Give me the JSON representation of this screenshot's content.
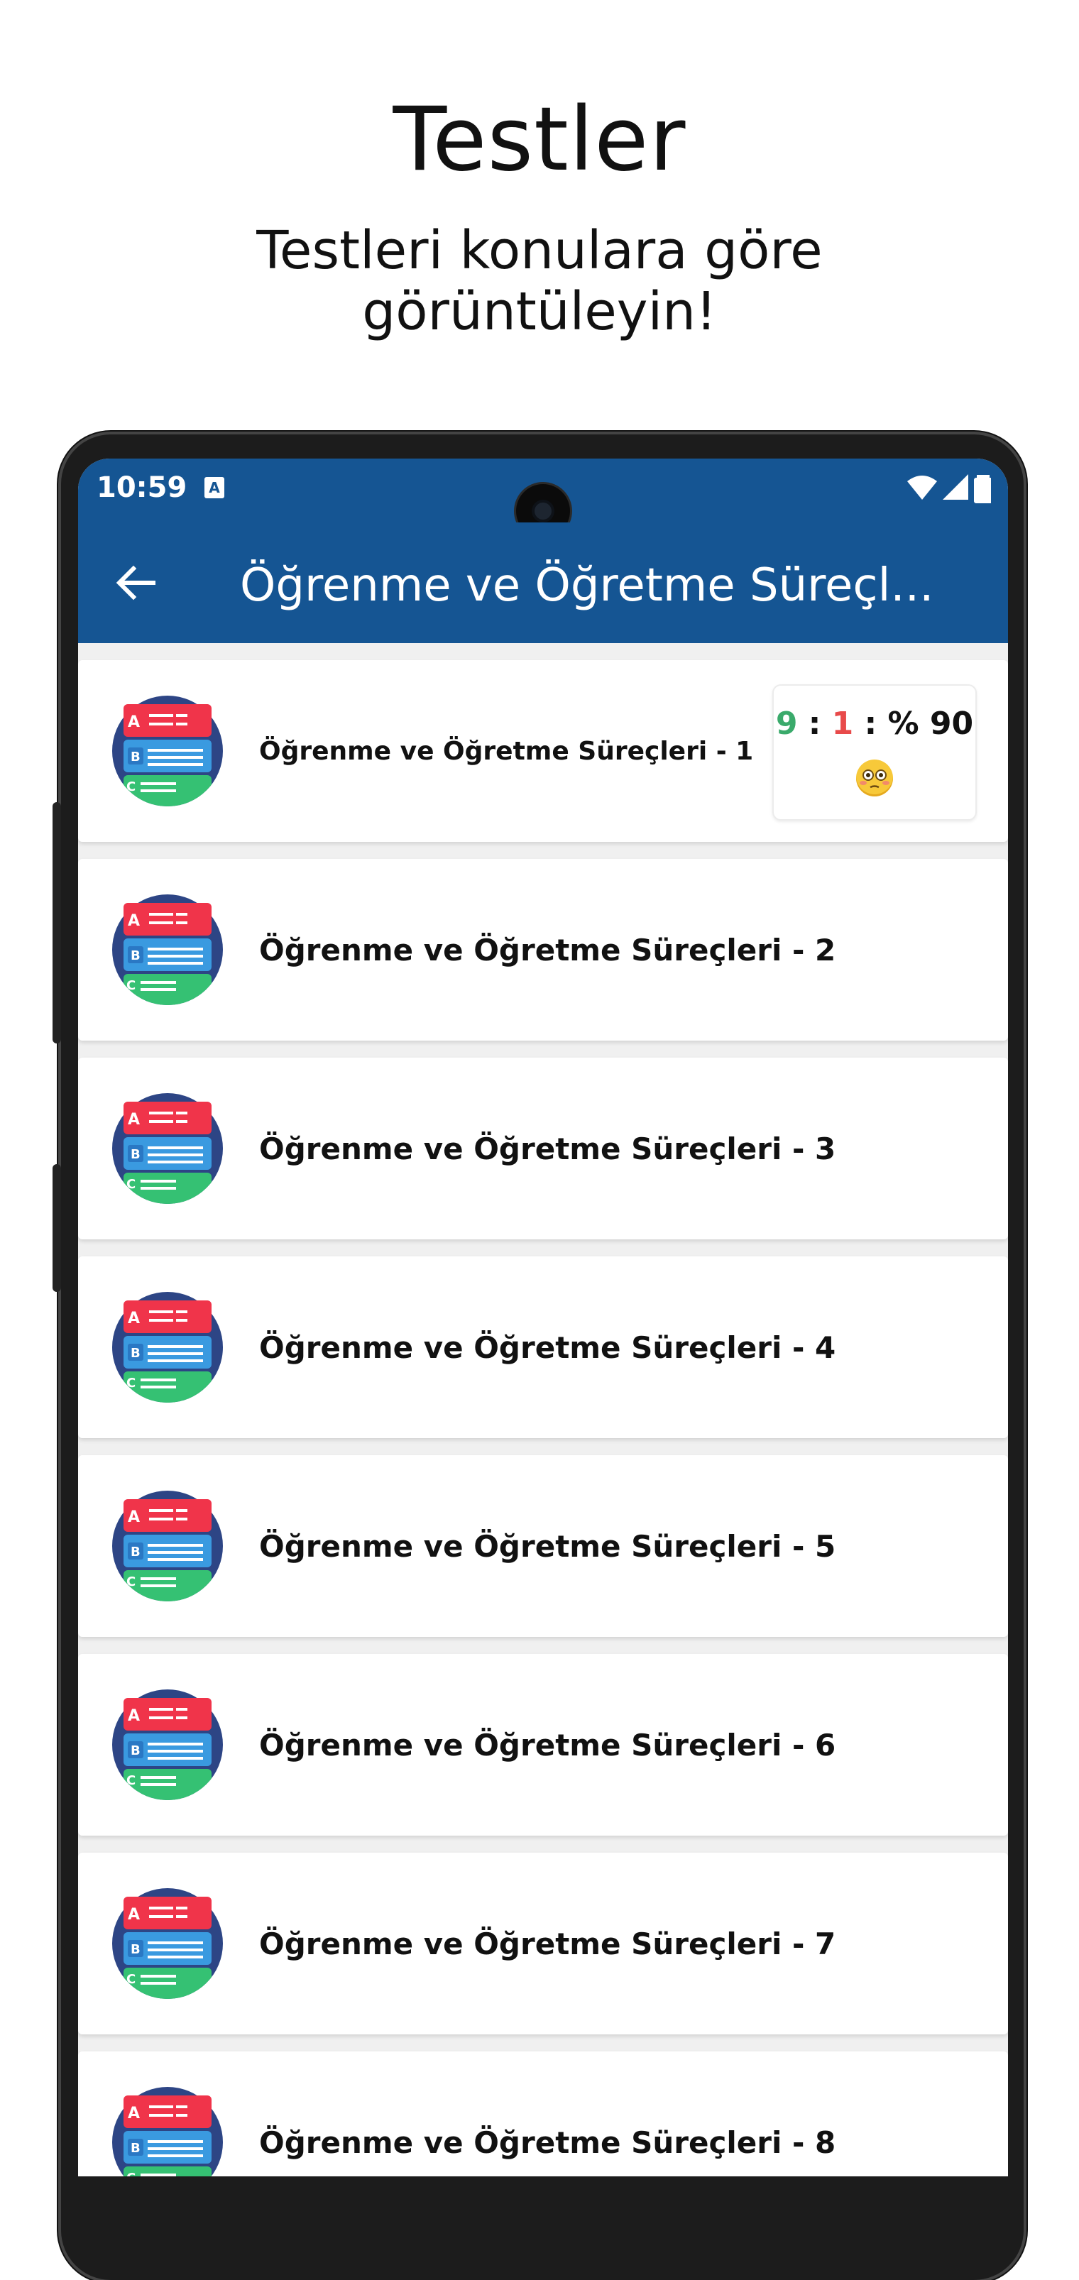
{
  "promo": {
    "title": "Testler",
    "subtitle": "Testleri konulara göre görüntüleyin!"
  },
  "status_bar": {
    "time": "10:59",
    "notification_icon": "a-icon",
    "icons": [
      "wifi-icon",
      "signal-icon",
      "battery-icon"
    ]
  },
  "app_bar": {
    "back_icon": "arrow-left-icon",
    "title": "Öğrenme ve Öğretme Süreçl..."
  },
  "tests": [
    {
      "title": "Öğrenme ve Öğretme Süreçleri - 1",
      "score": {
        "correct": "9",
        "wrong": "1",
        "percent_label": "% 90",
        "emoji": "flushed-face-emoji"
      }
    },
    {
      "title": "Öğrenme ve Öğretme Süreçleri - 2"
    },
    {
      "title": "Öğrenme ve Öğretme Süreçleri - 3"
    },
    {
      "title": "Öğrenme ve Öğretme Süreçleri - 4"
    },
    {
      "title": "Öğrenme ve Öğretme Süreçleri - 5"
    },
    {
      "title": "Öğrenme ve Öğretme Süreçleri - 6"
    },
    {
      "title": "Öğrenme ve Öğretme Süreçleri - 7"
    },
    {
      "title": "Öğrenme ve Öğretme Süreçleri - 8"
    }
  ],
  "colors": {
    "primary": "#155593",
    "correct": "#3aaa6b",
    "wrong": "#e84a4a",
    "icon_red": "#f0344a",
    "icon_blue": "#3a9ae0",
    "icon_green": "#35c173",
    "icon_circle": "#2d4585"
  }
}
